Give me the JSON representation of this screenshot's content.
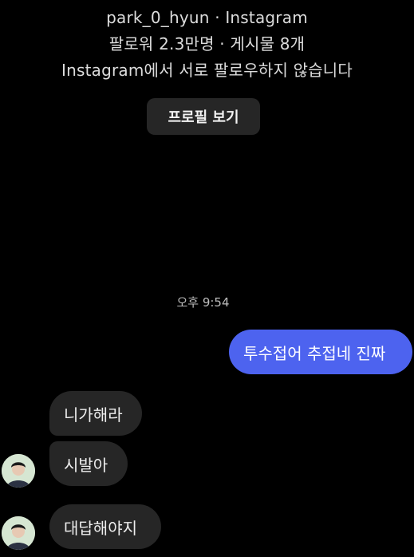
{
  "profile": {
    "name_line": "park_0_hyun · Instagram",
    "stats_line": "팔로워 2.3만명 · 게시물 8개",
    "follow_status": "Instagram에서 서로 팔로우하지 않습니다",
    "view_profile_label": "프로필 보기"
  },
  "chat": {
    "timestamp": "오후 9:54",
    "messages": [
      {
        "from": "me",
        "text": "투수접어 추접네 진짜"
      },
      {
        "from": "them",
        "text": "니가해라"
      },
      {
        "from": "them",
        "text": "시발아"
      },
      {
        "from": "them",
        "text": "대답해야지"
      }
    ]
  },
  "colors": {
    "background": "#000000",
    "sent_bubble": "#4d63ef",
    "received_bubble": "#262626",
    "button_bg": "#262626"
  }
}
